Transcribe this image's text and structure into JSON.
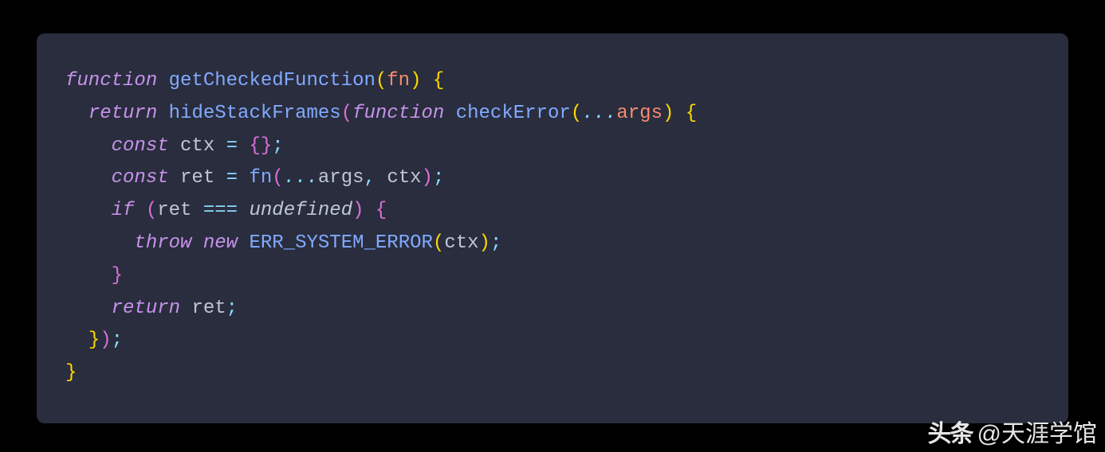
{
  "code": {
    "tokens": [
      [
        {
          "t": "function",
          "c": "kw"
        },
        {
          "t": " ",
          "c": ""
        },
        {
          "t": "getCheckedFunction",
          "c": "fn"
        },
        {
          "t": "(",
          "c": "br"
        },
        {
          "t": "fn",
          "c": "arg"
        },
        {
          "t": ")",
          "c": "br"
        },
        {
          "t": " ",
          "c": ""
        },
        {
          "t": "{",
          "c": "br"
        }
      ],
      [
        {
          "t": "  ",
          "c": ""
        },
        {
          "t": "return",
          "c": "kw"
        },
        {
          "t": " ",
          "c": ""
        },
        {
          "t": "hideStackFrames",
          "c": "fn"
        },
        {
          "t": "(",
          "c": "br2"
        },
        {
          "t": "function",
          "c": "kw"
        },
        {
          "t": " ",
          "c": ""
        },
        {
          "t": "checkError",
          "c": "fn"
        },
        {
          "t": "(",
          "c": "br"
        },
        {
          "t": "...",
          "c": "spread"
        },
        {
          "t": "args",
          "c": "arg"
        },
        {
          "t": ")",
          "c": "br"
        },
        {
          "t": " ",
          "c": ""
        },
        {
          "t": "{",
          "c": "br"
        }
      ],
      [
        {
          "t": "    ",
          "c": ""
        },
        {
          "t": "const",
          "c": "kw"
        },
        {
          "t": " ",
          "c": ""
        },
        {
          "t": "ctx",
          "c": "var"
        },
        {
          "t": " ",
          "c": ""
        },
        {
          "t": "=",
          "c": "op"
        },
        {
          "t": " ",
          "c": ""
        },
        {
          "t": "{}",
          "c": "br2"
        },
        {
          "t": ";",
          "c": "op"
        }
      ],
      [
        {
          "t": "    ",
          "c": ""
        },
        {
          "t": "const",
          "c": "kw"
        },
        {
          "t": " ",
          "c": ""
        },
        {
          "t": "ret",
          "c": "var"
        },
        {
          "t": " ",
          "c": ""
        },
        {
          "t": "=",
          "c": "op"
        },
        {
          "t": " ",
          "c": ""
        },
        {
          "t": "fn",
          "c": "fn"
        },
        {
          "t": "(",
          "c": "br2"
        },
        {
          "t": "...",
          "c": "spread"
        },
        {
          "t": "args",
          "c": "var"
        },
        {
          "t": ",",
          "c": "op"
        },
        {
          "t": " ",
          "c": ""
        },
        {
          "t": "ctx",
          "c": "var"
        },
        {
          "t": ")",
          "c": "br2"
        },
        {
          "t": ";",
          "c": "op"
        }
      ],
      [
        {
          "t": "    ",
          "c": ""
        },
        {
          "t": "if",
          "c": "kw"
        },
        {
          "t": " ",
          "c": ""
        },
        {
          "t": "(",
          "c": "br2"
        },
        {
          "t": "ret",
          "c": "var"
        },
        {
          "t": " ",
          "c": ""
        },
        {
          "t": "===",
          "c": "op"
        },
        {
          "t": " ",
          "c": ""
        },
        {
          "t": "undefined",
          "c": "undef"
        },
        {
          "t": ")",
          "c": "br2"
        },
        {
          "t": " ",
          "c": ""
        },
        {
          "t": "{",
          "c": "br2"
        }
      ],
      [
        {
          "t": "      ",
          "c": ""
        },
        {
          "t": "throw",
          "c": "kw"
        },
        {
          "t": " ",
          "c": ""
        },
        {
          "t": "new",
          "c": "kw"
        },
        {
          "t": " ",
          "c": ""
        },
        {
          "t": "ERR_SYSTEM_ERROR",
          "c": "fn"
        },
        {
          "t": "(",
          "c": "br"
        },
        {
          "t": "ctx",
          "c": "var"
        },
        {
          "t": ")",
          "c": "br"
        },
        {
          "t": ";",
          "c": "op"
        }
      ],
      [
        {
          "t": "    ",
          "c": ""
        },
        {
          "t": "}",
          "c": "br2"
        }
      ],
      [
        {
          "t": "    ",
          "c": ""
        },
        {
          "t": "return",
          "c": "kw"
        },
        {
          "t": " ",
          "c": ""
        },
        {
          "t": "ret",
          "c": "var"
        },
        {
          "t": ";",
          "c": "op"
        }
      ],
      [
        {
          "t": "  ",
          "c": ""
        },
        {
          "t": "}",
          "c": "br"
        },
        {
          "t": ")",
          "c": "br2"
        },
        {
          "t": ";",
          "c": "op"
        }
      ],
      [
        {
          "t": "}",
          "c": "br"
        }
      ]
    ]
  },
  "watermark": {
    "logo": "头条",
    "handle": "@天涯学馆"
  }
}
